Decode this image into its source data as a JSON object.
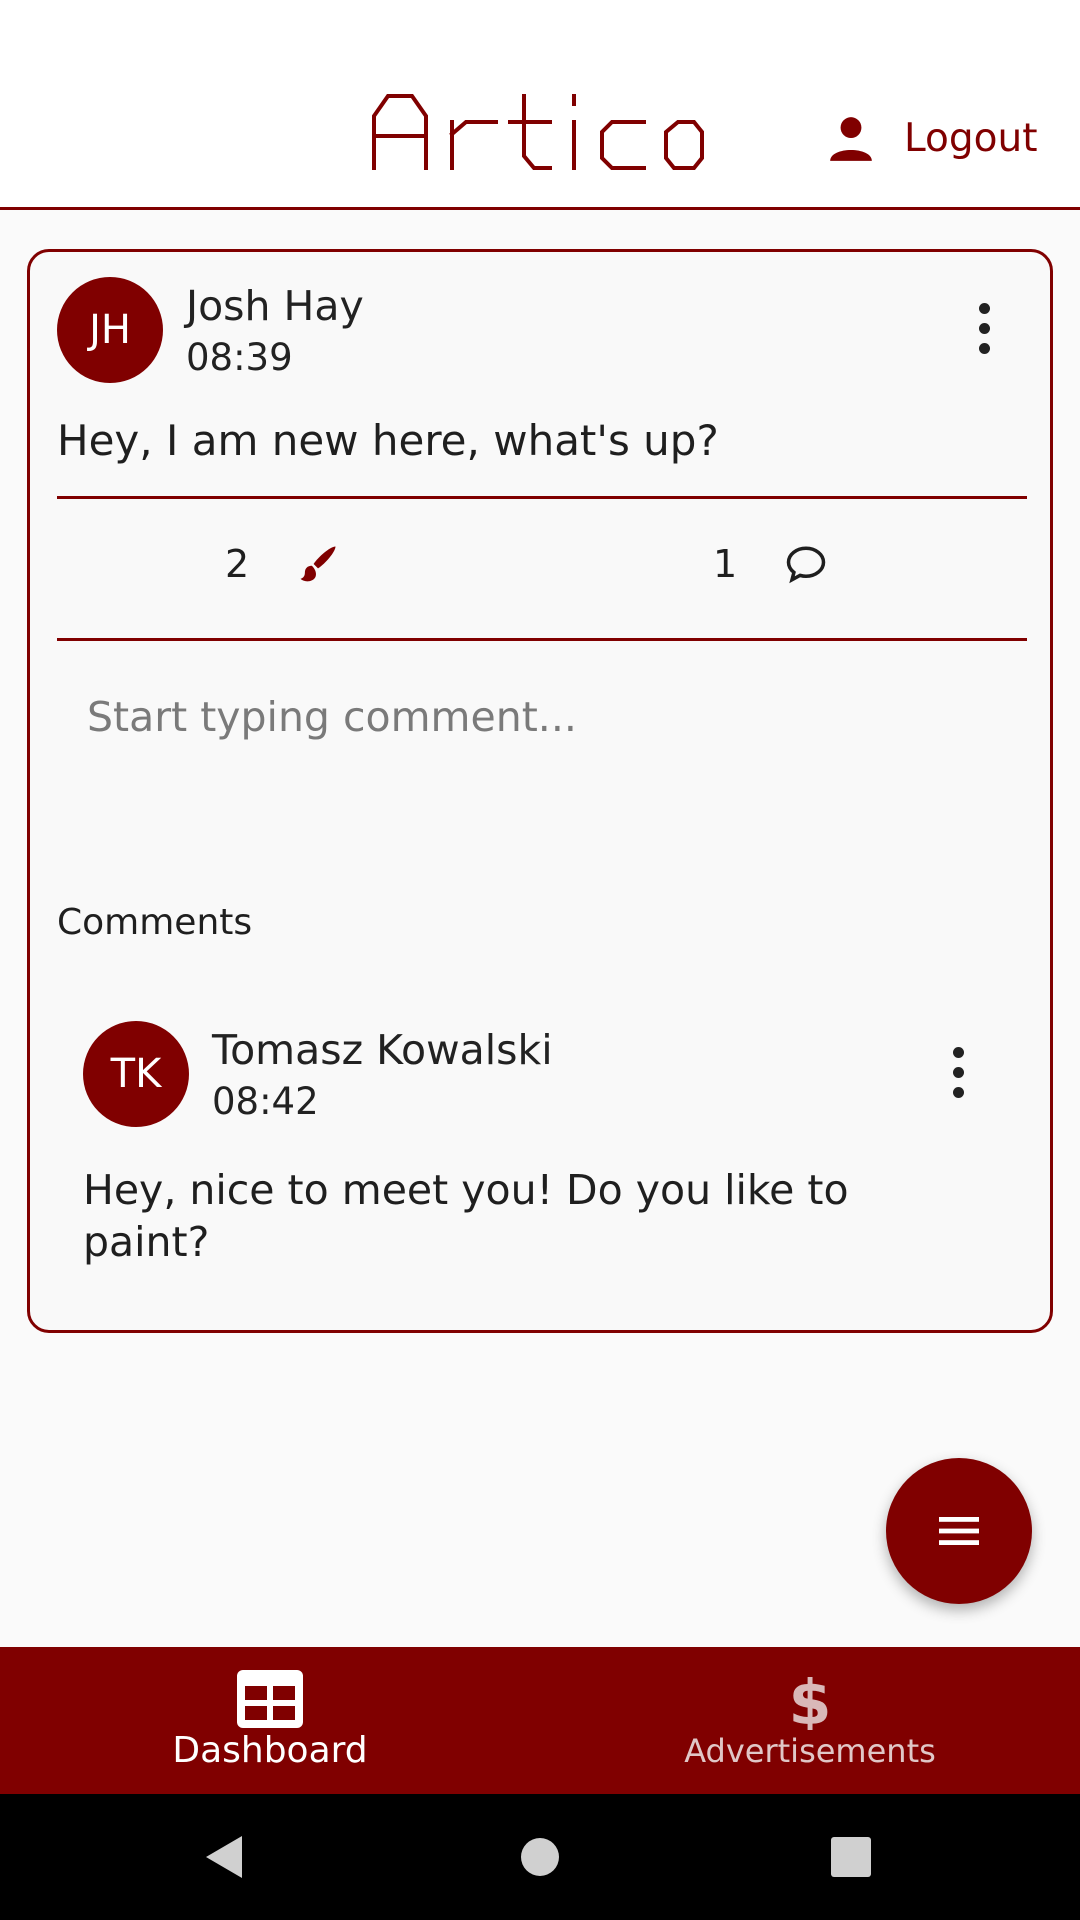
{
  "app": {
    "logo_text": "Artico",
    "logout_label": "Logout"
  },
  "post": {
    "author_initials": "JH",
    "author_name": "Josh Hay",
    "time": "08:39",
    "text": "Hey, I am new here, what's up?",
    "likes_count": "2",
    "comments_count": "1",
    "comment_placeholder": "Start typing comment..."
  },
  "comments": {
    "heading": "Comments",
    "items": [
      {
        "initials": "TK",
        "name": "Tomasz Kowalski",
        "time": "08:42",
        "text": "Hey, nice to meet you! Do you like to paint?"
      }
    ]
  },
  "bottom_nav": {
    "items": [
      {
        "label": "Dashboard",
        "icon": "grid-icon",
        "active": true
      },
      {
        "label": "Advertisements",
        "icon": "dollar-icon",
        "active": false
      }
    ]
  },
  "colors": {
    "brand": "#800000",
    "background": "#fafafa"
  }
}
